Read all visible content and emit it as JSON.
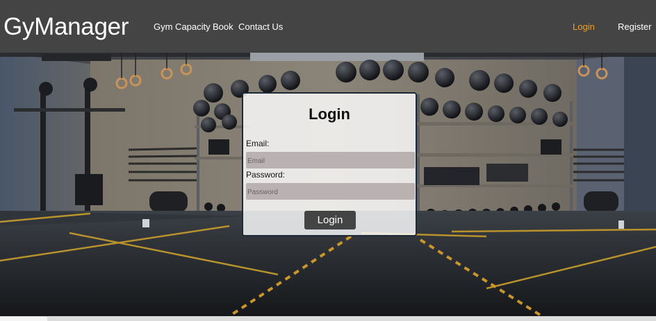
{
  "nav": {
    "brand": "GyManager",
    "links": [
      {
        "label": "Gym Capacity"
      },
      {
        "label": "Book"
      },
      {
        "label": "Contact Us"
      }
    ],
    "login": "Login",
    "register": "Register",
    "active_color": "#f0a020",
    "bar_color": "#444444"
  },
  "login_form": {
    "title": "Login",
    "email_label": "Email:",
    "email_placeholder": "Email",
    "password_label": "Password:",
    "password_placeholder": "Password",
    "submit": "Login"
  },
  "background": {
    "image": "gym-interior-photo"
  }
}
